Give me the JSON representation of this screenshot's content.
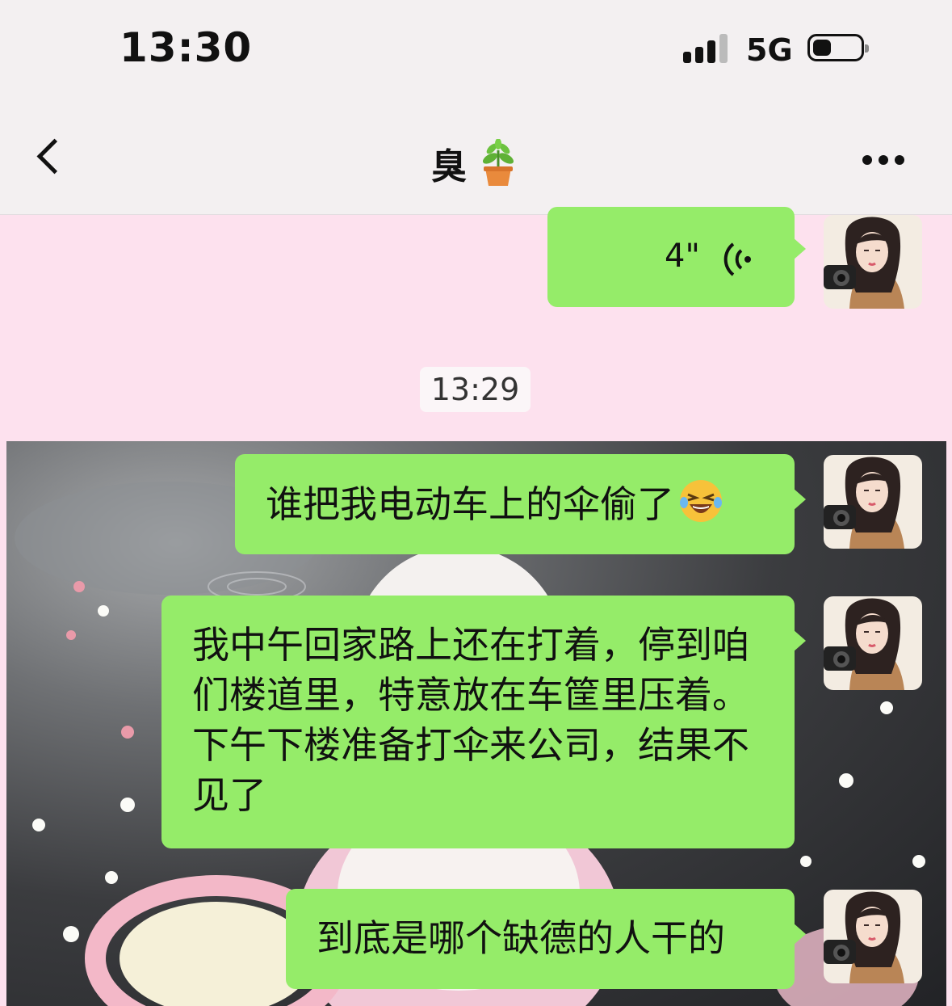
{
  "status_bar": {
    "time": "13:30",
    "network": "5G",
    "icons": [
      "signal-icon",
      "battery-icon"
    ]
  },
  "nav": {
    "title": "臭",
    "back_icon": "chevron-left-icon",
    "title_icon": "potted-plant-icon",
    "more_icon": "ellipsis-icon"
  },
  "chat": {
    "background_color": "#fde1ee",
    "bubble_color": "#95ec69",
    "timestamp": "13:29",
    "voice_message": {
      "duration": "4\"",
      "icon": "voice-wave-icon"
    },
    "messages": [
      {
        "text": "谁把我电动车上的伞偷了",
        "emoji": "laughing-crying-emoji"
      },
      {
        "text": "我中午回家路上还在打着，停到咱们楼道里，特意放在车筐里压着。下午下楼准备打伞来公司，结果不见了"
      },
      {
        "text": "到底是哪个缺德的人干的"
      }
    ],
    "avatar": "woman-with-camera-avatar",
    "background_image": "poodle-in-rain-photo"
  }
}
